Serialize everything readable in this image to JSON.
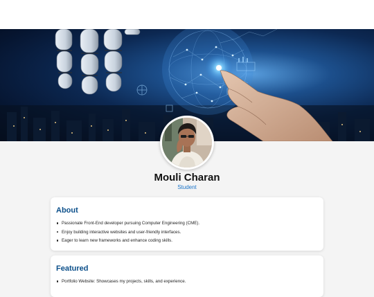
{
  "profile": {
    "name": "Mouli Charan",
    "role": "Student"
  },
  "about": {
    "title": "About",
    "items": [
      "Passionate Front-End developer pursuing Computer Engineering (CME).",
      "Enjoy building interactive websites and user-friendly interfaces.",
      "Eager to learn new frameworks and enhance coding skills."
    ]
  },
  "featured": {
    "title": "Featured",
    "items": [
      "Portfolio Website: Showcases my projects, skills, and experience."
    ]
  },
  "colors": {
    "accent": "#1a73c8",
    "heading": "#0b4f8a",
    "page_bg": "#f4f4f4",
    "card_bg": "#ffffff"
  }
}
